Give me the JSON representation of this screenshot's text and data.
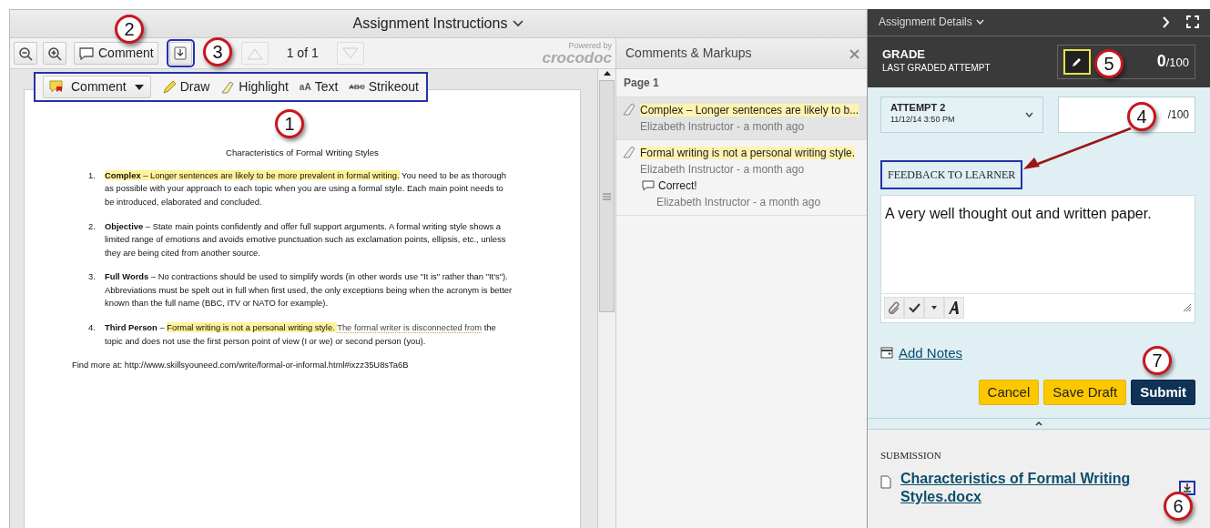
{
  "instructions_header": {
    "title": "Assignment Instructions"
  },
  "viewer_toolbar": {
    "comment_button": "Comment",
    "page_indicator": "1 of 1",
    "powered_by": "Powered by",
    "logo": "crocodoc"
  },
  "annotation_tools": [
    {
      "label": "Comment",
      "kind": "comment-dropdown"
    },
    {
      "label": "Draw",
      "kind": "draw"
    },
    {
      "label": "Highlight",
      "kind": "highlight"
    },
    {
      "label": "Text",
      "kind": "text",
      "glyph": "aA"
    },
    {
      "label": "Strikeout",
      "kind": "strikeout",
      "glyph": "ABC"
    }
  ],
  "document": {
    "title": "Characteristics of Formal Writing Styles",
    "items": [
      {
        "number": "1.",
        "segments": [
          {
            "text": "Complex",
            "kind": "bold-highlight"
          },
          {
            "text": " – Longer sentences are likely to be more prevalent in formal writing.",
            "kind": "highlight"
          },
          {
            "text": " You need to be as thorough as possible with your approach to each topic when you are using a formal style. Each main point needs to be introduced, elaborated and concluded.",
            "kind": "plain"
          }
        ]
      },
      {
        "number": "2.",
        "segments": [
          {
            "text": "Objective",
            "kind": "bold"
          },
          {
            "text": " – State main points confidently and offer full support arguments. A formal writing style shows a limited range of emotions and avoids emotive punctuation such as exclamation points, ellipsis, etc., unless they are being cited from another source.",
            "kind": "plain"
          }
        ]
      },
      {
        "number": "3.",
        "segments": [
          {
            "text": "Full Words",
            "kind": "bold"
          },
          {
            "text": " – No contractions should be used to simplify words (in other words use \"It is\" rather than \"It's\").  Abbreviations must be spelt out in full when first used, the only exceptions being when the acronym is better known than the full name (BBC, ITV or NATO for example).",
            "kind": "plain"
          }
        ]
      },
      {
        "number": "4.",
        "segments": [
          {
            "text": "Third Person",
            "kind": "bold"
          },
          {
            "text": " – ",
            "kind": "plain"
          },
          {
            "text": "Formal writing is not a personal writing style. ",
            "kind": "highlight"
          },
          {
            "text": " The formal writer is disconnected from",
            "kind": "strike"
          },
          {
            "text": " the topic and does not use the first person point of view (I or we) or second person (you).",
            "kind": "plain"
          }
        ]
      }
    ],
    "footer": "Find more at:  http://www.skillsyouneed.com/write/formal-or-informal.html#ixzz35U8sTa6B"
  },
  "comments_panel": {
    "title": "Comments & Markups",
    "page_label": "Page 1",
    "entries": [
      {
        "text": "Complex – Longer sentences are likely to b...",
        "meta": "Elizabeth Instructor - a month ago",
        "selected": true
      },
      {
        "text": "Formal writing is not a personal writing style.",
        "meta": "Elizabeth Instructor - a month ago",
        "selected": false,
        "replies": [
          {
            "text": "Correct!",
            "meta": "Elizabeth Instructor - a month ago"
          }
        ]
      }
    ]
  },
  "details": {
    "title": "Assignment Details",
    "grade": {
      "label": "GRADE",
      "sublabel": "LAST GRADED ATTEMPT",
      "score": "0",
      "out_of": "/100"
    },
    "attempt": {
      "label": "ATTEMPT 2",
      "date": "11/12/14 3:50 PM"
    },
    "score_field": {
      "out_of": "/100"
    },
    "feedback": {
      "heading": "FEEDBACK TO LEARNER",
      "text": "A very well thought out and written paper."
    },
    "add_notes": "Add Notes",
    "buttons": [
      {
        "label": "Cancel",
        "kind": "secondary"
      },
      {
        "label": "Save Draft",
        "kind": "secondary"
      },
      {
        "label": "Submit",
        "kind": "primary"
      }
    ],
    "submission": {
      "heading": "SUBMISSION",
      "file": "Characteristics of Formal Writing Styles.docx"
    }
  },
  "callouts": [
    {
      "label": "1"
    },
    {
      "label": "2"
    },
    {
      "label": "3"
    },
    {
      "label": "4"
    },
    {
      "label": "5"
    },
    {
      "label": "6"
    },
    {
      "label": "7"
    }
  ]
}
